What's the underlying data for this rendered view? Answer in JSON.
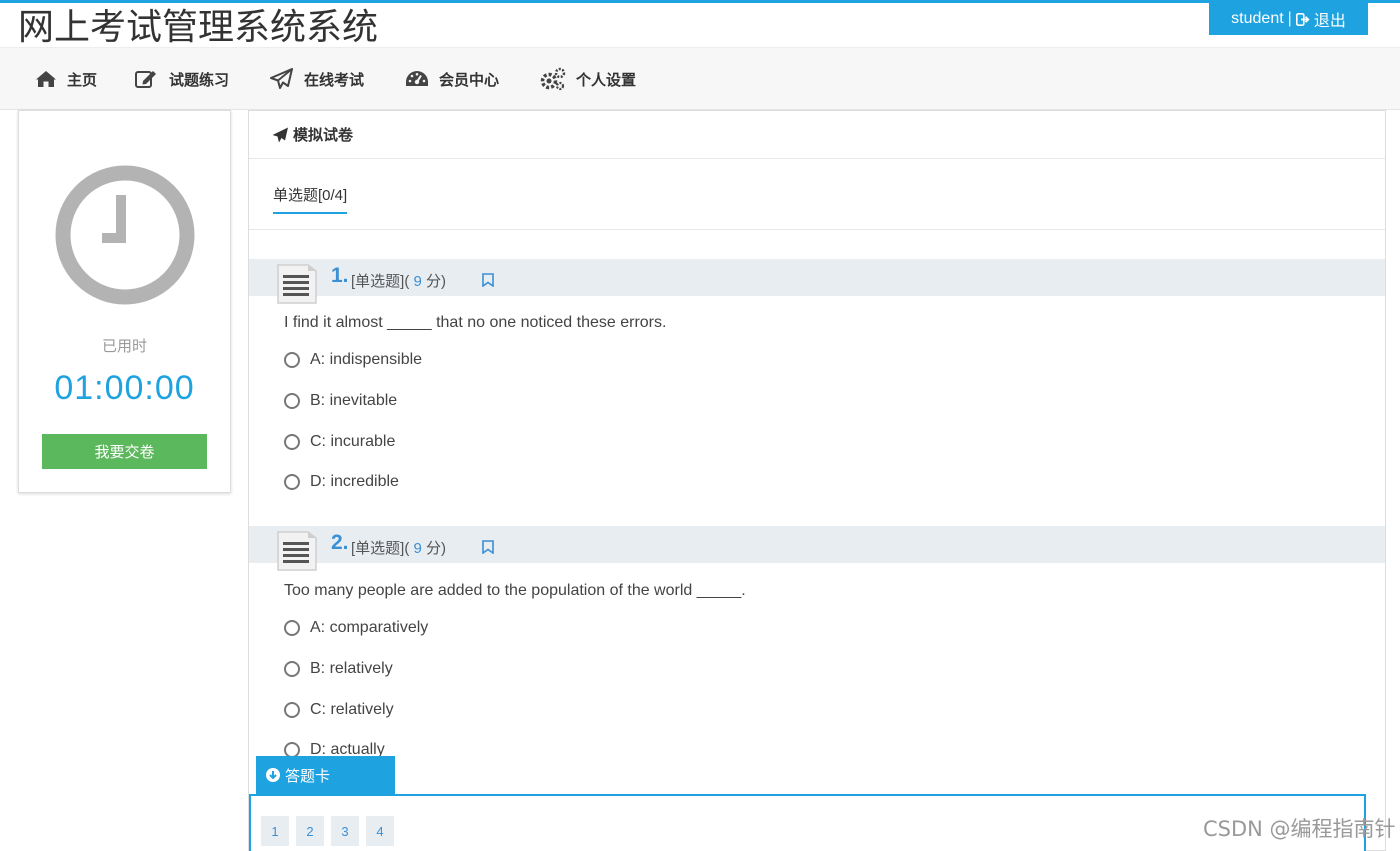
{
  "header": {
    "site_title": "网上考试管理系统系统",
    "username": "student",
    "separator": "|",
    "logout_label": "退出"
  },
  "nav": {
    "items": [
      {
        "label": "主页",
        "icon": "home-icon"
      },
      {
        "label": "试题练习",
        "icon": "edit-icon"
      },
      {
        "label": "在线考试",
        "icon": "paper-plane-icon"
      },
      {
        "label": "会员中心",
        "icon": "dashboard-icon"
      },
      {
        "label": "个人设置",
        "icon": "gears-icon"
      }
    ]
  },
  "timer": {
    "label": "已用时",
    "value": "01:00:00",
    "submit_label": "我要交卷"
  },
  "paper": {
    "title": "模拟试卷",
    "tab_label": "单选题[0/4]"
  },
  "questions": [
    {
      "number": "1.",
      "type": "[单选题](",
      "score": "9",
      "score_unit": "分)",
      "stem": "I find it almost _____ that no one noticed these errors.",
      "options": [
        "A: indispensible",
        "B: inevitable",
        "C: incurable",
        "D: incredible"
      ]
    },
    {
      "number": "2.",
      "type": "[单选题](",
      "score": "9",
      "score_unit": "分)",
      "stem": "Too many people are added to the population of the world _____.",
      "options": [
        "A: comparatively",
        "B: relatively",
        "C: relatively",
        "D: actually"
      ]
    }
  ],
  "answer_card": {
    "label": "答题卡",
    "numbers": [
      "1",
      "2",
      "3",
      "4"
    ]
  },
  "watermark": "CSDN @编程指南针",
  "colors": {
    "accent": "#1fa2e0",
    "submit": "#5cb85c",
    "question_number": "#3b8fd3",
    "question_header_bg": "#e8edf2"
  }
}
